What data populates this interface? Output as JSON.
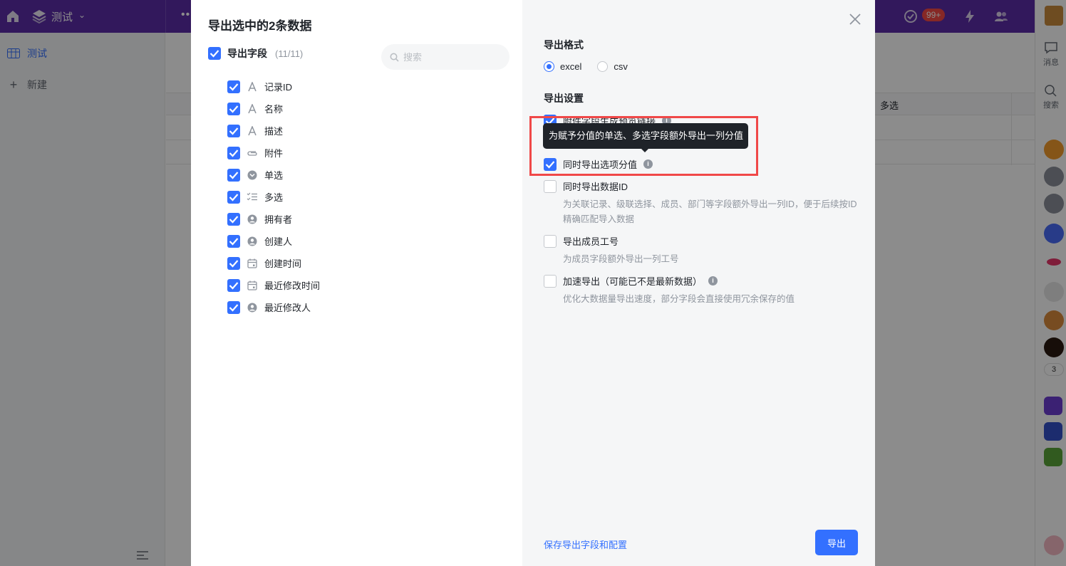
{
  "app": {
    "title": "测试",
    "badge": "99+",
    "side_nav": [
      {
        "label": "测试",
        "active": true
      },
      {
        "label": "新建",
        "active": false
      }
    ],
    "right_nav": [
      {
        "label": "消息"
      },
      {
        "label": "搜索"
      }
    ],
    "right_count": "3",
    "grid_col": "多选"
  },
  "modal": {
    "title": "导出选中的2条数据",
    "fields_label": "导出字段",
    "fields_count": "(11/11)",
    "search_placeholder": "搜索",
    "fields": [
      {
        "name": "记录ID",
        "icon": "text-icon",
        "checked": true
      },
      {
        "name": "名称",
        "icon": "text-icon",
        "checked": true
      },
      {
        "name": "描述",
        "icon": "text-icon",
        "checked": true
      },
      {
        "name": "附件",
        "icon": "attachment-icon",
        "checked": true
      },
      {
        "name": "单选",
        "icon": "single-select-icon",
        "checked": true
      },
      {
        "name": "多选",
        "icon": "multi-select-icon",
        "checked": true
      },
      {
        "name": "拥有者",
        "icon": "person-icon",
        "checked": true
      },
      {
        "name": "创建人",
        "icon": "person-icon",
        "checked": true
      },
      {
        "name": "创建时间",
        "icon": "calendar-icon",
        "checked": true
      },
      {
        "name": "最近修改时间",
        "icon": "calendar-icon",
        "checked": true
      },
      {
        "name": "最近修改人",
        "icon": "person-icon",
        "checked": true
      }
    ],
    "format_title": "导出格式",
    "format_options": [
      {
        "label": "excel",
        "selected": true
      },
      {
        "label": "csv",
        "selected": false
      }
    ],
    "settings_title": "导出设置",
    "settings": [
      {
        "label": "附件字段生成预览链接",
        "checked": true,
        "info": true,
        "desc": ""
      },
      {
        "label": "同时导出选项分值",
        "checked": true,
        "info": true,
        "desc": ""
      },
      {
        "label": "同时导出数据ID",
        "checked": false,
        "info": false,
        "desc": "为关联记录、级联选择、成员、部门等字段额外导出一列ID，便于后续按ID 精确匹配导入数据"
      },
      {
        "label": "导出成员工号",
        "checked": false,
        "info": false,
        "desc": "为成员字段额外导出一列工号"
      },
      {
        "label": "加速导出（可能已不是最新数据）",
        "checked": false,
        "info": true,
        "desc": "优化大数据量导出速度，部分字段会直接使用冗余保存的值"
      }
    ],
    "tooltip": "为赋予分值的单选、多选字段额外导出一列分值",
    "save_link": "保存导出字段和配置",
    "export_button": "导出"
  },
  "colors": {
    "accent": "#3370ff",
    "topbar": "#5b2ca8",
    "highlight": "#f04848"
  }
}
